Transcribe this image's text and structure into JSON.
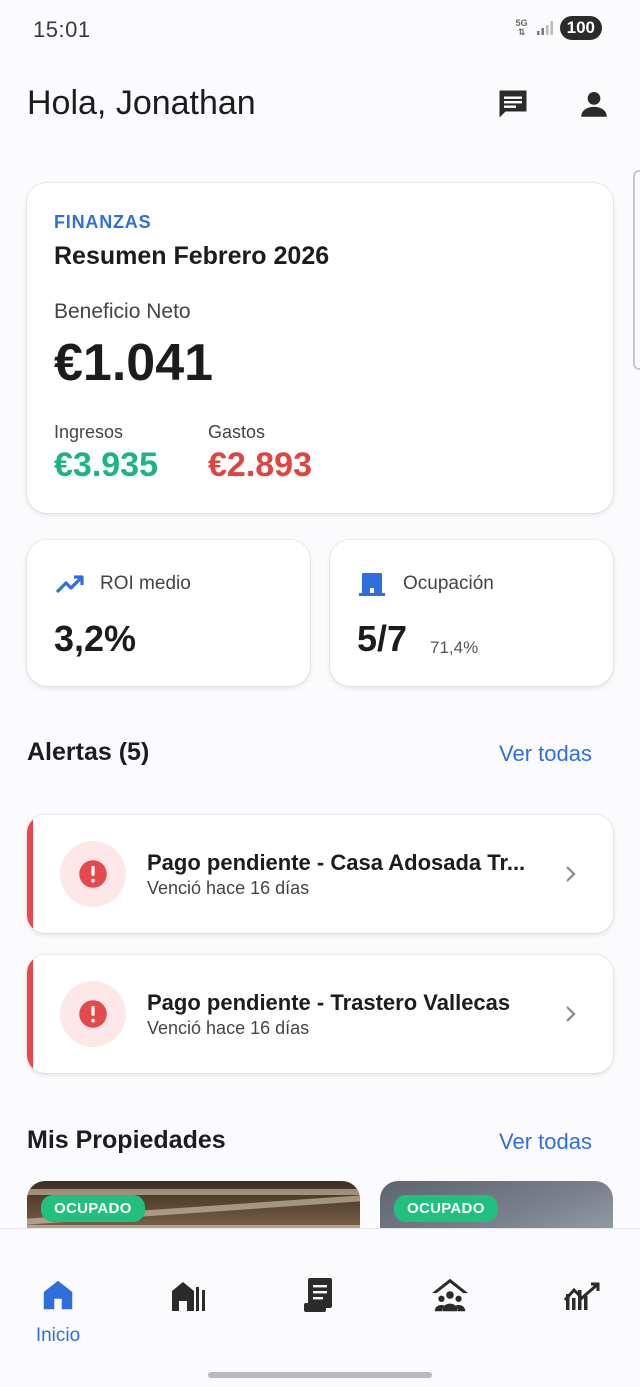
{
  "status_bar": {
    "time": "15:01",
    "network": "5G",
    "battery": "100"
  },
  "header": {
    "greeting": "Hola, Jonathan"
  },
  "finance": {
    "eyebrow": "FINANZAS",
    "title": "Resumen Febrero 2026",
    "net_label": "Beneficio Neto",
    "net_value": "€1.041",
    "income_label": "Ingresos",
    "income_value": "€3.935",
    "expenses_label": "Gastos",
    "expenses_value": "€2.893"
  },
  "stats": {
    "roi": {
      "label": "ROI medio",
      "value": "3,2%",
      "icon": "trending-up-icon"
    },
    "occupancy": {
      "label": "Ocupación",
      "value": "5/7",
      "sub": "71,4%",
      "icon": "building-icon"
    }
  },
  "alerts": {
    "title": "Alertas (5)",
    "link": "Ver todas",
    "items": [
      {
        "title": "Pago pendiente - Casa Adosada Tr...",
        "subtitle": "Venció hace 16 días"
      },
      {
        "title": "Pago pendiente - Trastero Vallecas",
        "subtitle": "Venció hace 16 días"
      }
    ]
  },
  "properties": {
    "title": "Mis Propiedades",
    "link": "Ver todas",
    "items": [
      {
        "badge": "OCUPADO"
      },
      {
        "badge": "OCUPADO"
      }
    ]
  },
  "colors": {
    "accent": "#2f6fdd",
    "income": "#1db57f",
    "expense": "#e0443f",
    "alert": "#e5484d",
    "badge": "#22c07f"
  },
  "bottom_nav": {
    "items": [
      {
        "label": "Inicio",
        "icon": "home-icon",
        "active": true
      },
      {
        "label": "",
        "icon": "properties-icon",
        "active": false
      },
      {
        "label": "",
        "icon": "contracts-icon",
        "active": false
      },
      {
        "label": "",
        "icon": "tenants-icon",
        "active": false
      },
      {
        "label": "",
        "icon": "analytics-icon",
        "active": false
      }
    ]
  }
}
